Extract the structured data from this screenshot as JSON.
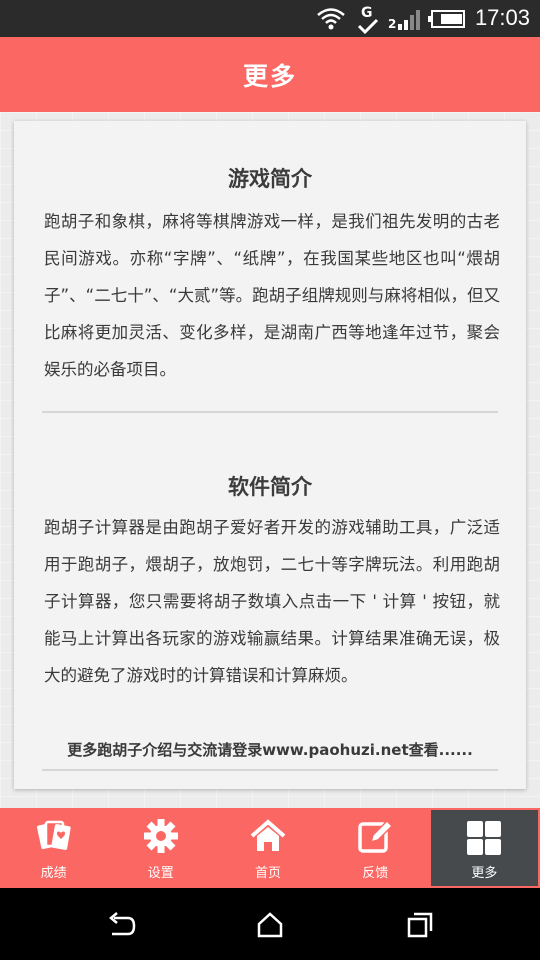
{
  "status_bar": {
    "time": "17:03",
    "icons": [
      "wifi-icon",
      "g-notification-icon",
      "check-icon",
      "signal-2g-icon",
      "battery-icon"
    ]
  },
  "header": {
    "title": "更多"
  },
  "sections": [
    {
      "title": "游戏简介",
      "body": "跑胡子和象棋，麻将等棋牌游戏一样，是我们祖先发明的古老民间游戏。亦称“字牌”、“纸牌”，在我国某些地区也叫“煨胡子”、“二七十”、“大贰”等。跑胡子组牌规则与麻将相似，但又比麻将更加灵活、变化多样，是湖南广西等地逢年过节，聚会娱乐的必备项目。"
    },
    {
      "title": "软件简介",
      "body": "跑胡子计算器是由跑胡子爱好者开发的游戏辅助工具，广泛适用于跑胡子，煨胡子，放炮罚，二七十等字牌玩法。利用跑胡子计算器，您只需要将胡子数填入点击一下 ' 计算 ' 按钮，就能马上计算出各玩家的游戏输赢结果。计算结果准确无误，极大的避免了游戏时的计算错误和计算麻烦。"
    }
  ],
  "footer_note": "更多跑胡子介绍与交流请登录www.paohuzi.net查看......",
  "bottom_nav": {
    "items": [
      {
        "label": "成绩",
        "icon": "cards-icon"
      },
      {
        "label": "设置",
        "icon": "gear-icon"
      },
      {
        "label": "首页",
        "icon": "home-icon"
      },
      {
        "label": "反馈",
        "icon": "edit-icon"
      },
      {
        "label": "更多",
        "icon": "grid-icon",
        "active": true
      }
    ]
  },
  "system_nav": [
    "back-icon",
    "home-outline-icon",
    "recents-icon"
  ],
  "colors": {
    "accent": "#fb6763",
    "active_tab": "#464a4c",
    "background": "#ececec",
    "card": "#f3f3f3"
  }
}
